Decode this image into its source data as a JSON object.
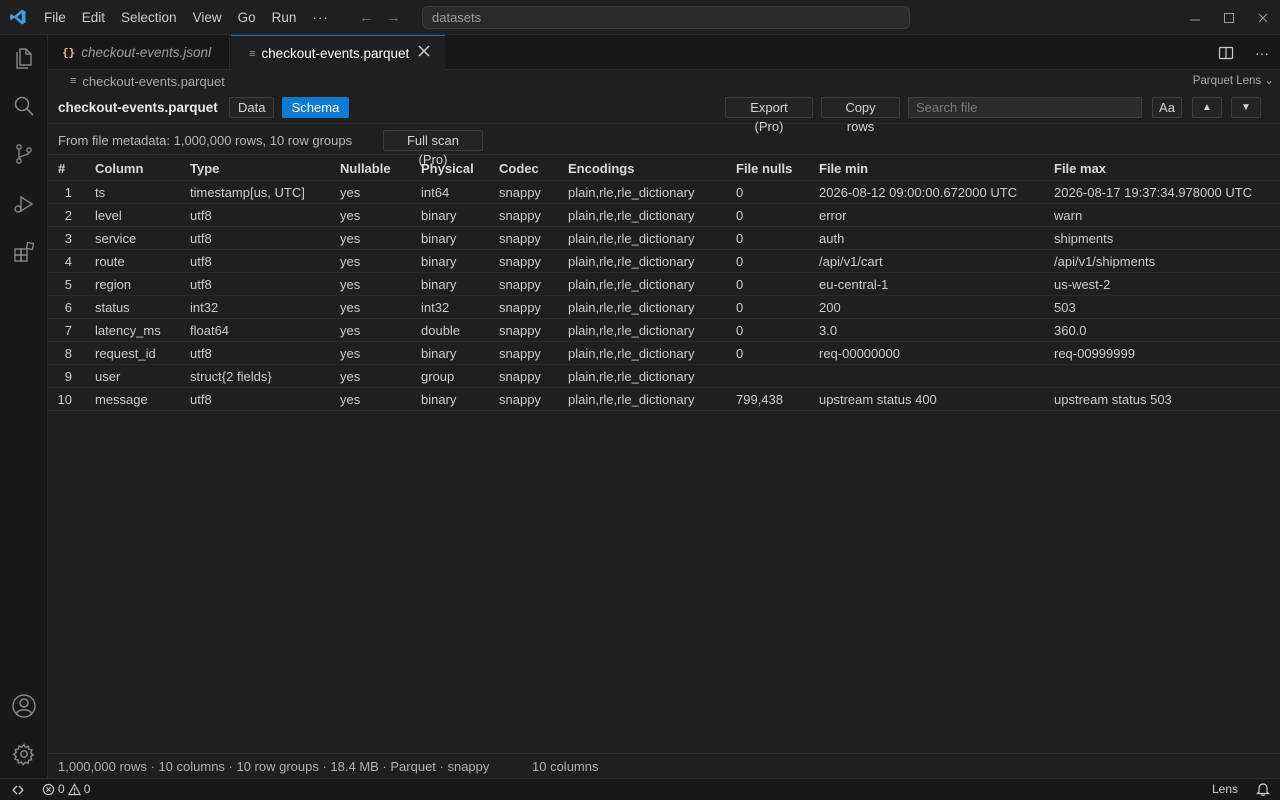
{
  "menu": {
    "items": [
      "File",
      "Edit",
      "Selection",
      "View",
      "Go",
      "Run"
    ],
    "more": "···"
  },
  "command_center": {
    "text": "datasets"
  },
  "tabs": [
    {
      "label": "checkout-events.jsonl",
      "icon": "{}"
    },
    {
      "label": "checkout-events.parquet",
      "icon": "≡"
    }
  ],
  "breadcrumb": {
    "label": "checkout-events.parquet"
  },
  "lens_menu": {
    "label": "Parquet Lens"
  },
  "toolbar": {
    "filename": "checkout-events.parquet",
    "data_label": "Data",
    "schema_label": "Schema",
    "export_label": "Export (Pro)",
    "copy_label": "Copy rows",
    "search_placeholder": "Search file",
    "case_label": "Aa",
    "prev_label": "▲",
    "next_label": "▼"
  },
  "meta": {
    "text": "From file metadata: 1,000,000 rows, 10 row groups",
    "full_scan_label": "Full scan (Pro)"
  },
  "table": {
    "headers": [
      "#",
      "Column",
      "Type",
      "Nullable",
      "Physical",
      "Codec",
      "Encodings",
      "File nulls",
      "File min",
      "File max"
    ],
    "rows": [
      [
        "1",
        "ts",
        "timestamp[us, UTC]",
        "yes",
        "int64",
        "snappy",
        "plain,rle,rle_dictionary",
        "0",
        "2026-08-12 09:00:00.672000 UTC",
        "2026-08-17 19:37:34.978000 UTC"
      ],
      [
        "2",
        "level",
        "utf8",
        "yes",
        "binary",
        "snappy",
        "plain,rle,rle_dictionary",
        "0",
        "error",
        "warn"
      ],
      [
        "3",
        "service",
        "utf8",
        "yes",
        "binary",
        "snappy",
        "plain,rle,rle_dictionary",
        "0",
        "auth",
        "shipments"
      ],
      [
        "4",
        "route",
        "utf8",
        "yes",
        "binary",
        "snappy",
        "plain,rle,rle_dictionary",
        "0",
        "/api/v1/cart",
        "/api/v1/shipments"
      ],
      [
        "5",
        "region",
        "utf8",
        "yes",
        "binary",
        "snappy",
        "plain,rle,rle_dictionary",
        "0",
        "eu-central-1",
        "us-west-2"
      ],
      [
        "6",
        "status",
        "int32",
        "yes",
        "int32",
        "snappy",
        "plain,rle,rle_dictionary",
        "0",
        "200",
        "503"
      ],
      [
        "7",
        "latency_ms",
        "float64",
        "yes",
        "double",
        "snappy",
        "plain,rle,rle_dictionary",
        "0",
        "3.0",
        "360.0"
      ],
      [
        "8",
        "request_id",
        "utf8",
        "yes",
        "binary",
        "snappy",
        "plain,rle,rle_dictionary",
        "0",
        "req-00000000",
        "req-00999999"
      ],
      [
        "9",
        "user",
        "struct{2 fields}",
        "yes",
        "group",
        "snappy",
        "plain,rle,rle_dictionary",
        "",
        "",
        ""
      ],
      [
        "10",
        "message",
        "utf8",
        "yes",
        "binary",
        "snappy",
        "plain,rle,rle_dictionary",
        "799,438",
        "upstream status 400",
        "upstream status 503"
      ]
    ]
  },
  "footer": {
    "summary": "1,000,000 rows · 10 columns · 10 row groups · 18.4 MB · Parquet · snappy",
    "columns": "10 columns"
  },
  "statusbar": {
    "errors": "0",
    "warnings": "0",
    "lens": "Lens"
  },
  "colors": {
    "accent": "#0e7ad3",
    "logo": "#3ca0e6"
  }
}
